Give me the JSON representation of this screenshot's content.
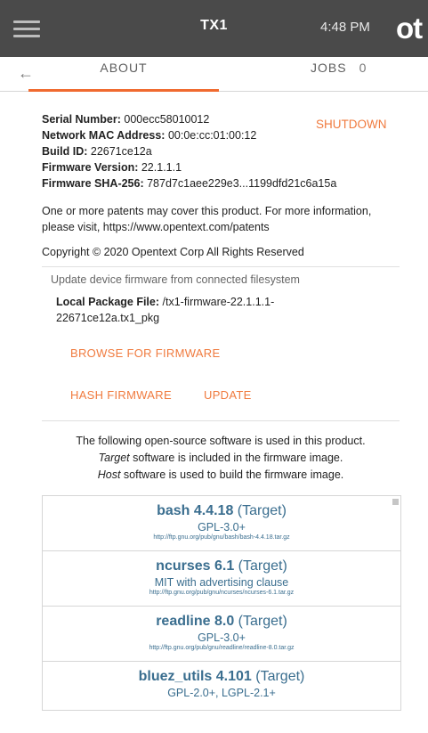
{
  "header": {
    "title": "TX1",
    "time": "4:48 PM",
    "logo": "ot"
  },
  "tabs": {
    "about": "ABOUT",
    "jobs": "JOBS",
    "jobs_count": "0"
  },
  "device": {
    "serial_label": "Serial Number:",
    "serial_value": "000ecc58010012",
    "mac_label": "Network MAC Address:",
    "mac_value": "00:0e:cc:01:00:12",
    "build_label": "Build ID:",
    "build_value": "22671ce12a",
    "fw_label": "Firmware Version:",
    "fw_value": "22.1.1.1",
    "sha_label": "Firmware SHA-256:",
    "sha_value": "787d7c1aee229e3...1199dfd21c6a15a",
    "shutdown_label": "SHUTDOWN"
  },
  "patent_text": "One or more patents may cover this product. For more information, please visit, https://www.opentext.com/patents",
  "copyright_text": "Copyright © 2020 Opentext Corp All Rights Reserved",
  "update": {
    "heading": "Update device firmware from connected filesystem",
    "local_label": "Local Package File:",
    "local_value": "/tx1-firmware-22.1.1.1-22671ce12a.tx1_pkg",
    "browse_label": "BROWSE FOR FIRMWARE",
    "hash_label": "HASH FIRMWARE",
    "update_label": "UPDATE"
  },
  "oss": {
    "line1": "The following open-source software is used in this product.",
    "line2_em": "Target",
    "line2_rest": " software is included in the firmware image.",
    "line3_em": "Host",
    "line3_rest": " software is used to build the firmware image."
  },
  "packages": [
    {
      "name": "bash 4.4.18",
      "tag": " (Target)",
      "license": "GPL-3.0+",
      "url": "http://ftp.gnu.org/pub/gnu/bash/bash-4.4.18.tar.gz"
    },
    {
      "name": "ncurses 6.1",
      "tag": " (Target)",
      "license": "MIT with advertising clause",
      "url": "http://ftp.gnu.org/pub/gnu/ncurses/ncurses-6.1.tar.gz"
    },
    {
      "name": "readline 8.0",
      "tag": " (Target)",
      "license": "GPL-3.0+",
      "url": "http://ftp.gnu.org/pub/gnu/readline/readline-8.0.tar.gz"
    },
    {
      "name": "bluez_utils 4.101",
      "tag": " (Target)",
      "license": "GPL-2.0+, LGPL-2.1+",
      "url": ""
    }
  ]
}
